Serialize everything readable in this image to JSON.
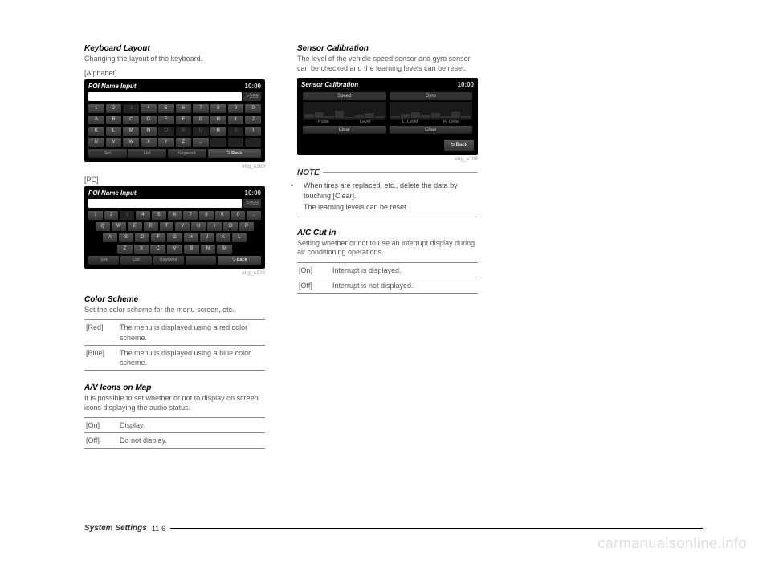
{
  "left": {
    "keyboard_layout": {
      "heading": "Keyboard Layout",
      "desc": "Changing the layout of the keyboard.",
      "alphabet_label": "[Alphabet]",
      "pc_label": "[PC]",
      "caption_alpha": "eng_a169",
      "caption_pc": "eng_a170"
    },
    "screenshot_common": {
      "title": "POI Name Input",
      "clock": "10:00",
      "arrow": ">999",
      "set": "Set",
      "list": "List",
      "keyword": "Keyword",
      "back": "⮌ Back"
    },
    "kb_alpha": {
      "r1": [
        "1",
        "2",
        "3",
        "4",
        "5",
        "6",
        "7",
        "8",
        "9",
        "0"
      ],
      "r2": [
        "A",
        "B",
        "C",
        "D",
        "E",
        "F",
        "G",
        "H",
        "I",
        "J"
      ],
      "r3": [
        "K",
        "L",
        "M",
        "N",
        "O",
        "P",
        "Q",
        "R",
        "S",
        "T"
      ],
      "r4": [
        "U",
        "V",
        "W",
        "X",
        "Y",
        "Z",
        "..",
        "",
        "",
        ""
      ]
    },
    "kb_pc": {
      "r1": [
        "1",
        "2",
        "3",
        "4",
        "5",
        "6",
        "7",
        "8",
        "9",
        "0",
        ".."
      ],
      "r2": [
        "Q",
        "W",
        "E",
        "R",
        "T",
        "Y",
        "U",
        "I",
        "O",
        "P"
      ],
      "r3": [
        "A",
        "S",
        "D",
        "F",
        "G",
        "H",
        "J",
        "K",
        "L"
      ],
      "r4": [
        "Z",
        "X",
        "C",
        "V",
        "B",
        "N",
        "M"
      ]
    },
    "color_scheme": {
      "heading": "Color Scheme",
      "desc": "Set the color scheme for the menu screen, etc.",
      "rows": [
        {
          "k": "[Red]",
          "v": "The menu is displayed using a red color scheme."
        },
        {
          "k": "[Blue]",
          "v": "The menu is displayed using a blue color scheme."
        }
      ]
    },
    "av_icons": {
      "heading": "A/V Icons on Map",
      "desc": "It is possible to set whether or not to display on screen icons displaying the audio status.",
      "rows": [
        {
          "k": "[On]",
          "v": "Display."
        },
        {
          "k": "[Off]",
          "v": "Do not display."
        }
      ]
    }
  },
  "right": {
    "sensor": {
      "heading": "Sensor Calibration",
      "desc": "The level of the vehicle speed sensor and gyro sensor can be checked and the learning levels can be reset.",
      "caption": "eng_a206",
      "title": "Sensor Calibration",
      "clock": "10:00",
      "speed_label": "Speed",
      "gyro_label": "Gyro",
      "pulse": "Pulse",
      "level": "Level",
      "l_level": "L. Level",
      "r_level": "R. Level",
      "clear": "Clear",
      "back": "⮌ Back"
    },
    "note": {
      "heading": "NOTE",
      "line1": "When tires are replaced, etc., delete the data by touching [Clear].",
      "line2": "The learning levels can be reset."
    },
    "ac": {
      "heading": "A/C Cut in",
      "desc": "Setting whether or not to use an interrupt display during air conditioning operations.",
      "rows": [
        {
          "k": "[On]",
          "v": "Interrupt is displayed."
        },
        {
          "k": "[Off]",
          "v": "Interrupt is not displayed."
        }
      ]
    }
  },
  "footer": {
    "label": "System Settings",
    "page": "11-6"
  },
  "watermark": "carmanualsonline.info"
}
